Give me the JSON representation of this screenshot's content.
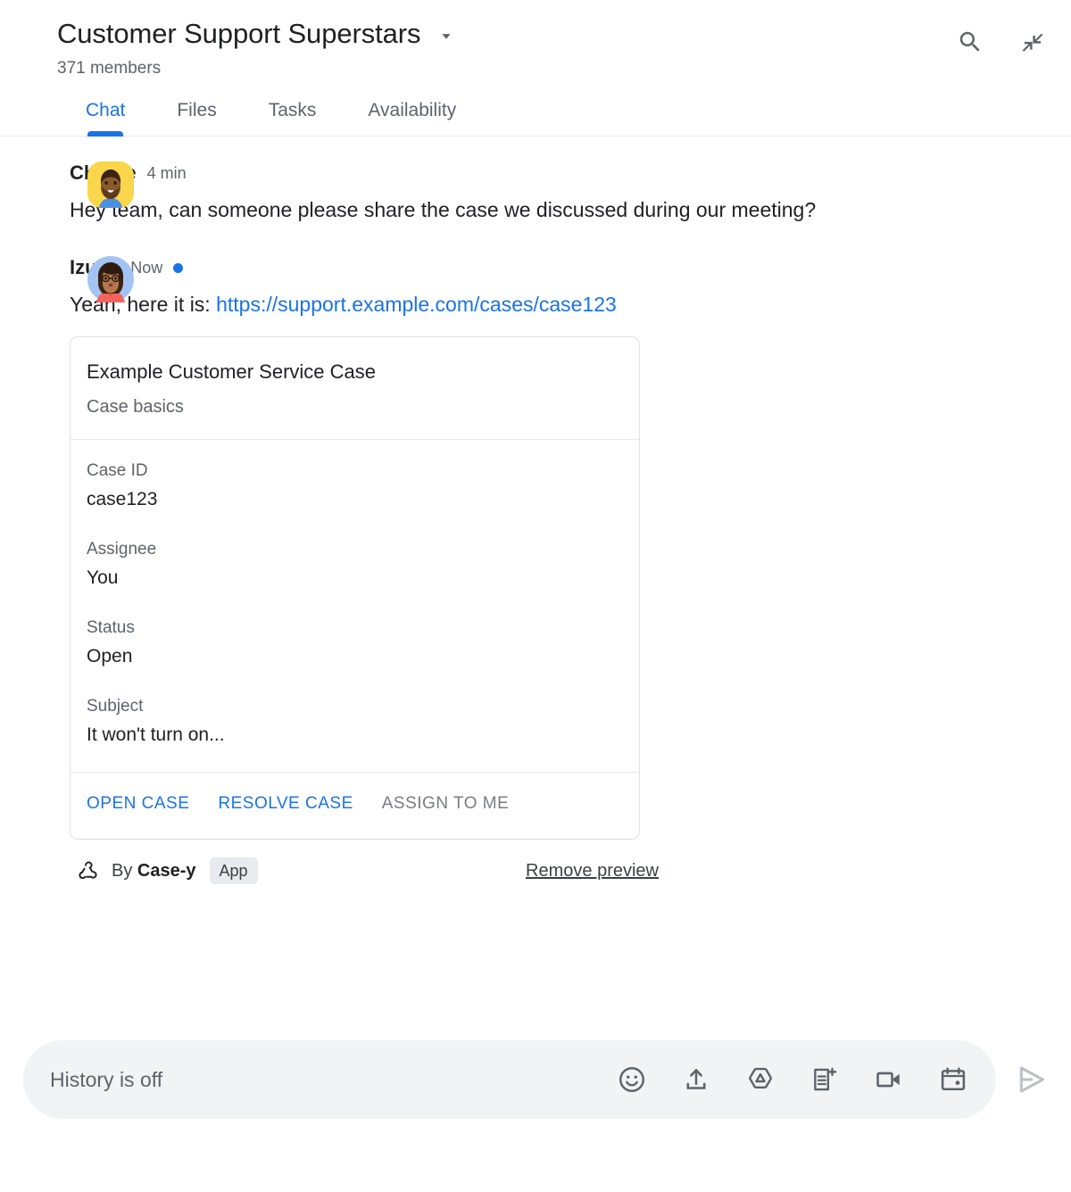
{
  "header": {
    "space_title": "Customer Support Superstars",
    "member_count": "371 members",
    "dropdown_icon": "chevron-down-icon",
    "search_icon": "search-icon",
    "collapse_icon": "collapse-icon",
    "accent_color": "#1a73e8"
  },
  "tabs": [
    {
      "label": "Chat",
      "active": true
    },
    {
      "label": "Files",
      "active": false
    },
    {
      "label": "Tasks",
      "active": false
    },
    {
      "label": "Availability",
      "active": false
    }
  ],
  "messages": [
    {
      "sender": "Charlie",
      "timestamp": "4 min",
      "unread": false,
      "text": "Hey team, can someone please share the case we discussed during our meeting?",
      "avatar": "charlie-avatar"
    },
    {
      "sender": "Izumi",
      "timestamp": "Now",
      "unread": true,
      "text_prefix": "Yeah, here it is: ",
      "link_text": "https://support.example.com/cases/case123",
      "avatar": "izumi-avatar"
    }
  ],
  "card": {
    "title": "Example Customer Service Case",
    "subtitle": "Case basics",
    "fields": [
      {
        "label": "Case ID",
        "value": "case123"
      },
      {
        "label": "Assignee",
        "value": "You"
      },
      {
        "label": "Status",
        "value": "Open"
      },
      {
        "label": "Subject",
        "value": "It won't turn on..."
      }
    ],
    "actions": [
      {
        "label": "OPEN CASE",
        "enabled": true
      },
      {
        "label": "RESOLVE CASE",
        "enabled": true
      },
      {
        "label": "ASSIGN TO ME",
        "enabled": false
      }
    ]
  },
  "attribution": {
    "icon": "webhook-icon",
    "by_text": "By ",
    "app_name": "Case-y",
    "badge": "App",
    "remove_link": "Remove preview"
  },
  "compose": {
    "placeholder": "History is off",
    "value": "",
    "tools": [
      "emoji-icon",
      "upload-icon",
      "google-drive-icon",
      "add-document-icon",
      "video-camera-icon",
      "calendar-icon"
    ],
    "send_icon": "send-icon"
  }
}
